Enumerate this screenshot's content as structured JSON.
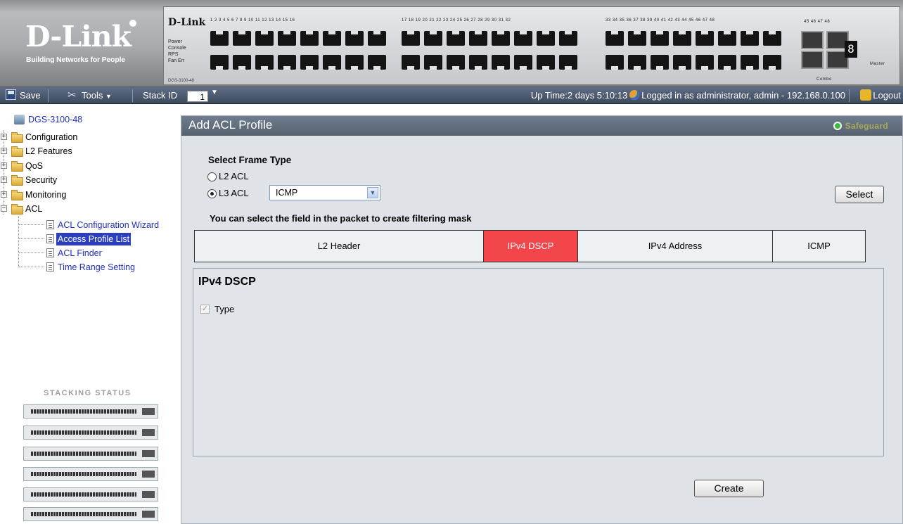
{
  "banner": {
    "logo_brand": "D-Link",
    "logo_tagline": "Building Networks for People",
    "panel_brand": "D-Link",
    "panel_leds": [
      "Power",
      "Console",
      "RPS",
      "Fan Err"
    ],
    "panel_model": "DGS-3100-48",
    "port_numbers_group1": "1 2 3 4 5 6 7 8 9 10 11 12 13 14 15 16",
    "port_numbers_group2": "17 18 19 20 21 22 23 24 25 26 27 28 29 30 31 32",
    "port_numbers_group3": "33 34 35 36 37 38 39 40 41 42 43 44 45 46 47 48",
    "sfp_labels": "45 46   47 48",
    "combo_label": "Combo",
    "master_label": "Master",
    "stack_digit": "8"
  },
  "toolbar": {
    "save_label": "Save",
    "tools_label": "Tools",
    "stack_id_label": "Stack ID",
    "stack_id_value": "1",
    "uptime": "Up Time:2 days 5:10:13",
    "logged_in": "Logged in as administrator, admin - 192.168.0.100",
    "logout_label": "Logout"
  },
  "tree": {
    "root": "DGS-3100-48",
    "folders": [
      "Configuration",
      "L2 Features",
      "QoS",
      "Security",
      "Monitoring",
      "ACL"
    ],
    "acl_items": [
      "ACL Configuration Wizard",
      "Access Profile List",
      "ACL Finder",
      "Time Range Setting"
    ],
    "selected_item": "Access Profile List"
  },
  "stacking": {
    "title": "STACKING STATUS",
    "unit_count": 6
  },
  "main": {
    "title": "Add ACL Profile",
    "safeguard": "Safeguard",
    "frame_type_heading": "Select Frame Type",
    "radio_l2": "L2 ACL",
    "radio_l3": "L3 ACL",
    "selected_radio": "L3 ACL",
    "l3_protocol_value": "ICMP",
    "select_button": "Select",
    "mask_hint": "You can select the field in the packet to create filtering mask",
    "field_tabs": [
      "L2 Header",
      "IPv4 DSCP",
      "IPv4 Address",
      "ICMP"
    ],
    "active_field_tab": "IPv4 DSCP",
    "panel_title": "IPv4 DSCP",
    "type_checkbox_label": "Type",
    "type_checked": true,
    "create_button": "Create"
  },
  "colors": {
    "active_tab": "#f2464a",
    "title_bar": "#616d7d",
    "tree_link": "#1f2fbf",
    "tree_selected_bg": "#2b3fbf",
    "safeguard_led": "#3bbd3b"
  }
}
